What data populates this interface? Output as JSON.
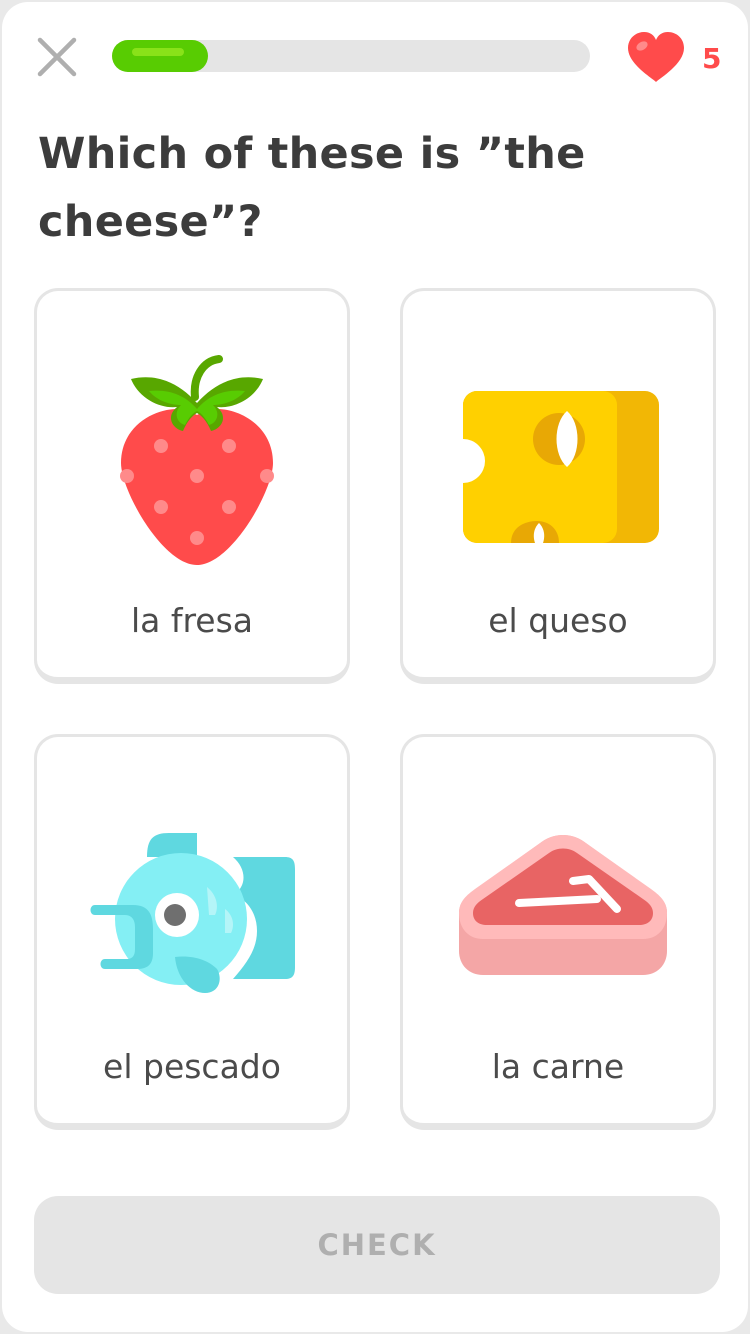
{
  "header": {
    "close_icon": "close-icon",
    "progress": 0.2,
    "hearts_icon": "heart-icon",
    "hearts_count": "5",
    "colors": {
      "progress": "#58cc02",
      "heart": "#ff4b4b"
    }
  },
  "question": "Which of these is ”the cheese”?",
  "choices": [
    {
      "label": "la fresa",
      "icon": "strawberry-icon"
    },
    {
      "label": "el queso",
      "icon": "cheese-icon"
    },
    {
      "label": "el pescado",
      "icon": "fish-icon"
    },
    {
      "label": "la carne",
      "icon": "meat-icon"
    }
  ],
  "footer": {
    "check_label": "CHECK"
  }
}
